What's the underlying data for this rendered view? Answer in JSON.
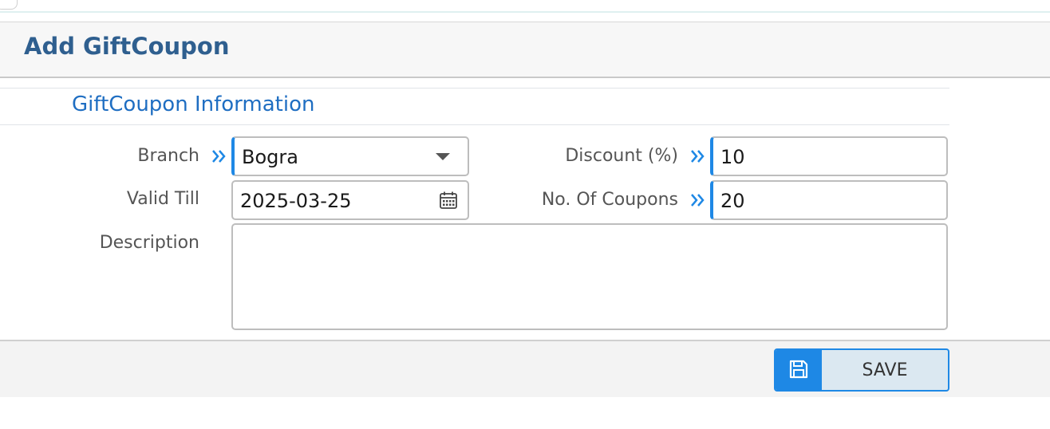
{
  "header": {
    "title": "Add GiftCoupon"
  },
  "section": {
    "title": "GiftCoupon Information"
  },
  "form": {
    "branch": {
      "label": "Branch",
      "value": "Bogra"
    },
    "discount": {
      "label": "Discount (%)",
      "value": "10"
    },
    "valid_till": {
      "label": "Valid Till",
      "value": "2025-03-25"
    },
    "coupons": {
      "label": "No. Of Coupons",
      "value": "20"
    },
    "description": {
      "label": "Description",
      "value": ""
    }
  },
  "footer": {
    "save_label": "SAVE"
  },
  "icons": {
    "required": "double-chevron-right-icon",
    "dropdown": "caret-down-icon",
    "calendar": "calendar-icon",
    "save": "floppy-disk-icon"
  },
  "colors": {
    "accent": "#1e88e5",
    "title": "#2f5f8f",
    "section_title": "#1f6ec2"
  }
}
